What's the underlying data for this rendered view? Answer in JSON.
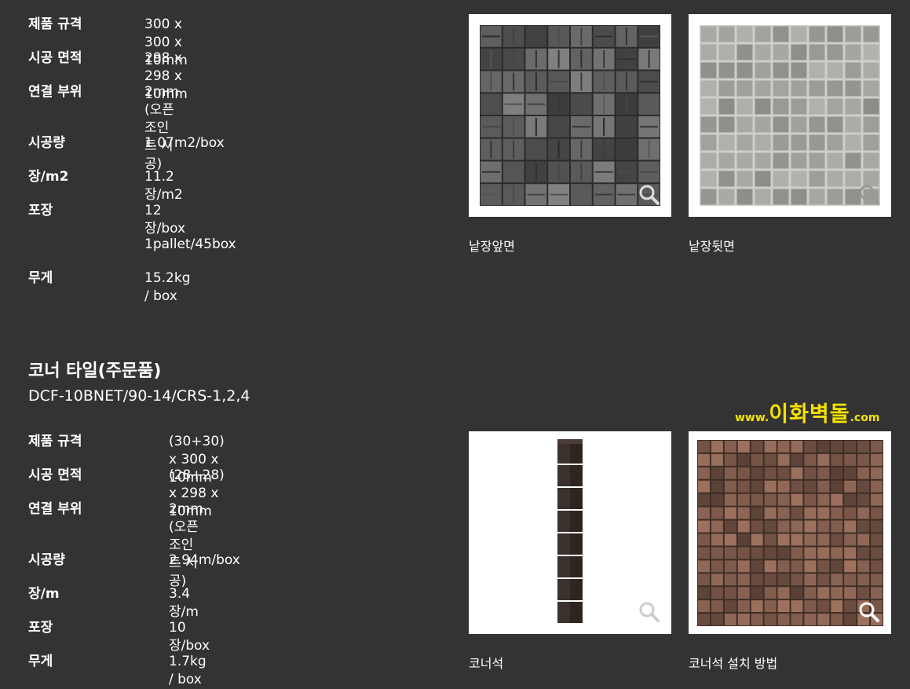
{
  "spec1": {
    "rows": [
      {
        "label": "제품 규격",
        "value": "300 x 300 x 10mm"
      },
      {
        "label": "시공 면적",
        "value": "298 x 298 x 10mm"
      },
      {
        "label": "연결 부위",
        "value": "2mm\n(오픈조인트 시공)"
      },
      {
        "label": "시공량",
        "value": "1.07m2/box"
      },
      {
        "label": "장/m2",
        "value": "11.2장/m2"
      },
      {
        "label": "포장",
        "value": "12장/box"
      },
      {
        "label": "",
        "value": "1pallet/45box"
      },
      {
        "label": "무게",
        "value": "15.2kg / box"
      }
    ]
  },
  "images1": [
    {
      "caption": "낱장앞면",
      "icon": "zoom-icon"
    },
    {
      "caption": "낱장뒷면",
      "icon": "zoom-icon"
    }
  ],
  "section2": {
    "title": "코너 타일(주문품)",
    "code": "DCF-10BNET/90-14/CRS-1,2,4"
  },
  "watermark": {
    "prefix": "www.",
    "name": "이화벽돌",
    "suffix": ".com",
    "color": "#f5e300"
  },
  "spec2": {
    "rows": [
      {
        "label": "제품 규격",
        "value": "(30+30) x 300 x 10mm"
      },
      {
        "label": "시공 면적",
        "value": "(28+28) x 298 x 10mm"
      },
      {
        "label": "연결 부위",
        "value": "2mm\n(오픈조인트 시공)"
      },
      {
        "label": "시공량",
        "value": "2.94m/box"
      },
      {
        "label": "장/m",
        "value": "3.4장/m"
      },
      {
        "label": "포장",
        "value": "10장/box"
      },
      {
        "label": "무게",
        "value": "1.7kg / box"
      }
    ]
  },
  "images2": [
    {
      "caption": "코너석",
      "icon": "zoom-icon"
    },
    {
      "caption": "코너석 설치 방법",
      "icon": "zoom-icon"
    }
  ]
}
